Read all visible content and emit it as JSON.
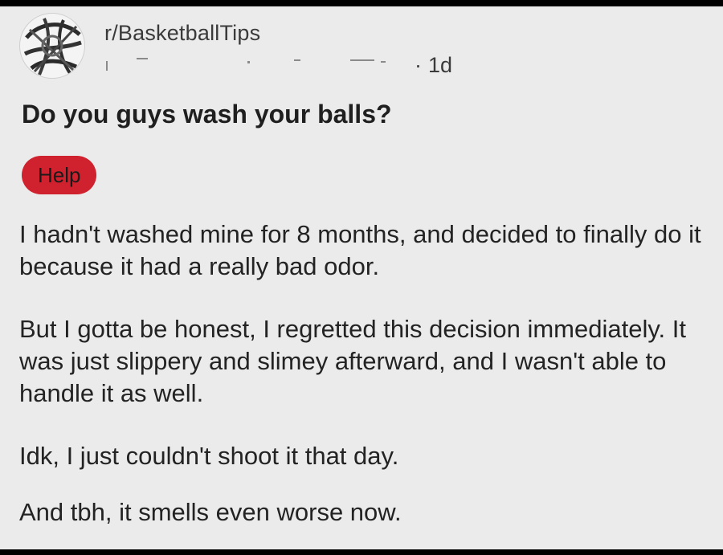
{
  "post": {
    "subreddit": "r/BasketballTips",
    "time": "1d",
    "separator": "·",
    "title": "Do you guys wash your balls?",
    "flair": {
      "label": "Help",
      "color": "#d0222e"
    },
    "paragraphs": [
      "I hadn't washed mine for 8 months, and decided to finally do it because it had a really bad odor.",
      "But I gotta be honest, I regretted this decision immediately. It was just slippery and slimey afterward, and I wasn't able to handle it as well.",
      "Idk, I just couldn't shoot it that day.",
      "And tbh, it smells even worse now."
    ]
  },
  "icons": {
    "avatar": "subreddit-avatar-icon"
  }
}
